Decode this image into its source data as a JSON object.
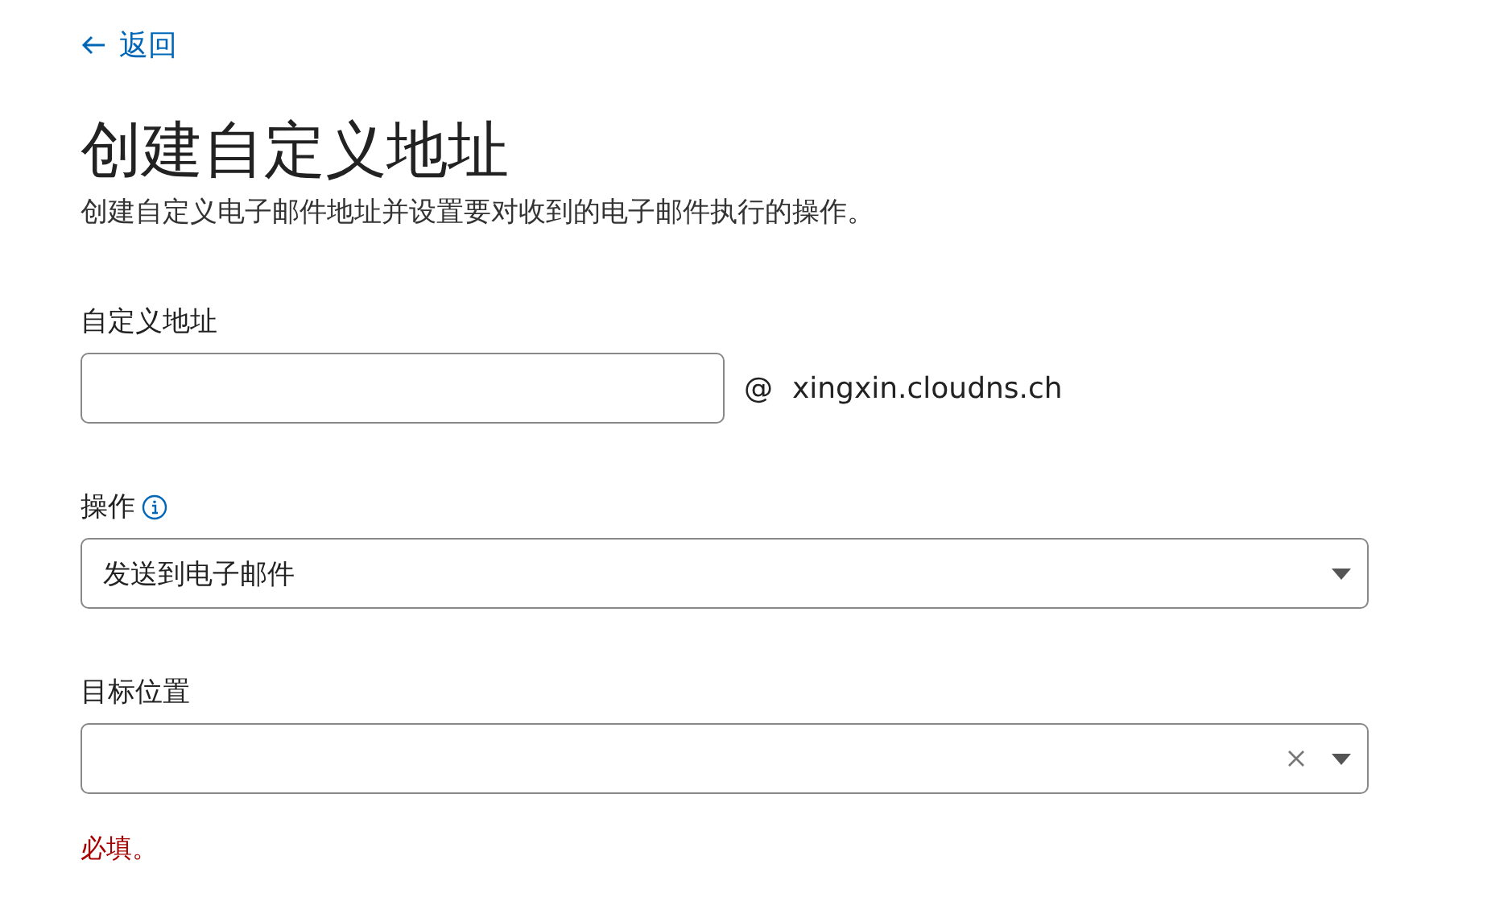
{
  "back_link": {
    "label": "返回"
  },
  "title": "创建自定义地址",
  "subtitle": "创建自定义电子邮件地址并设置要对收到的电子邮件执行的操作。",
  "fields": [
    {
      "kind": "text",
      "label": "自定义地址",
      "at": "@",
      "domain": "xingxin.cloudns.ch"
    },
    {
      "kind": "select",
      "label": "操作",
      "info": true,
      "value": "发送到电子邮件"
    },
    {
      "kind": "select",
      "label": "目标位置",
      "clearable": true,
      "error": "必填。"
    }
  ]
}
